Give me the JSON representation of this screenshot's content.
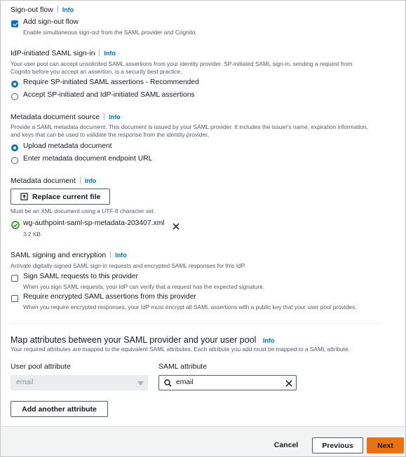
{
  "signout": {
    "title": "Sign-out flow",
    "info": "Info",
    "checkbox_label": "Add sign-out flow",
    "checkbox_desc": "Enable simultaneous sign-out from the SAML provider and Cognito."
  },
  "idp_signin": {
    "title": "IdP-initiated SAML sign-in",
    "info": "Info",
    "desc_line1": "Your user pool can accept unsolicited SAML assertions from your identity provider. SP-initiated SAML sign-in, sending a request from",
    "desc_line2": "Cognito before you accept an assertion, is a security best practice.",
    "options": [
      {
        "label": "Require SP-initiated SAML assertions - Recommended",
        "selected": true
      },
      {
        "label": "Accept SP-initiated and IdP-initiated SAML assertions",
        "selected": false
      }
    ]
  },
  "metadata_source": {
    "title": "Metadata document source",
    "info": "Info",
    "desc_line1": "Provide a SAML metadata document. This document is issued by your SAML provider. It includes the issuer's name, expiration information,",
    "desc_line2": "and keys that can be used to validate the response from the identity provider.",
    "options": [
      {
        "label": "Upload metadata document",
        "selected": true
      },
      {
        "label": "Enter metadata document endpoint URL",
        "selected": false
      }
    ]
  },
  "metadata_doc": {
    "title": "Metadata document",
    "info": "Info",
    "button_label": "Replace current file",
    "hint": "Must be an XML document using a UTF-8 character set.",
    "file_name": "wg-authpoint-saml-sp-metadata-203407.xml",
    "file_size": "3.2 KB"
  },
  "signing": {
    "title": "SAML signing and encryption",
    "info": "Info",
    "desc": "Activate digitally-signed SAML sign-in requests and encrypted SAML responses for this IdP.",
    "options": [
      {
        "label": "Sign SAML requests to this provider",
        "desc": "When you sign SAML requests, your IdP can verify that a request has the expected signature.",
        "checked": false
      },
      {
        "label": "Require encrypted SAML assertions from this provider",
        "desc": "When you require encrypted responses, your IdP must encrypt all SAML assertions with a public key that your user pool provides.",
        "checked": false
      }
    ]
  },
  "map_attributes": {
    "title": "Map attributes between your SAML provider and your user pool",
    "info": "Info",
    "desc": "Your required attributes are mapped to the equivalent SAML attributes. Each attribute you add must be mapped to a SAML attribute.",
    "col_user_pool": "User pool attribute",
    "col_saml": "SAML attribute",
    "user_pool_value": "email",
    "saml_value": "email",
    "add_button": "Add another attribute"
  },
  "footer": {
    "cancel": "Cancel",
    "previous": "Previous",
    "next": "Next"
  },
  "colors": {
    "accent": "#0073bb",
    "primary_button": "#ec7211",
    "success": "#1d8102"
  }
}
